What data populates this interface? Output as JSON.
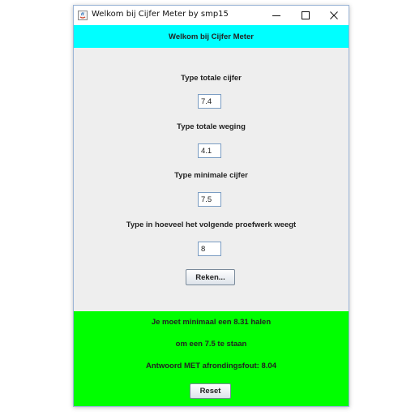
{
  "window": {
    "title": "Welkom bij Cijfer Meter by smp15",
    "controls": {
      "minimize_icon": "minimize-icon",
      "maximize_icon": "maximize-icon",
      "close_icon": "close-icon"
    }
  },
  "header": {
    "text": "Welkom bij Cijfer Meter",
    "background": "#00ffff"
  },
  "form": {
    "total_grade": {
      "label": "Type totale cijfer",
      "value": "7.4"
    },
    "total_weight": {
      "label": "Type totale weging",
      "value": "4.1"
    },
    "min_grade": {
      "label": "Type minimale cijfer",
      "value": "7.5"
    },
    "next_weight": {
      "label": "Type in hoeveel het volgende proefwerk weegt",
      "value": "8"
    },
    "calculate_label": "Reken..."
  },
  "result": {
    "background": "#00ff00",
    "line1": "Je moet minimaal een 8.31 halen",
    "line2": "om een 7.5 te staan",
    "line3": "Antwoord MET afrondingsfout: 8.04",
    "reset_label": "Reset"
  }
}
